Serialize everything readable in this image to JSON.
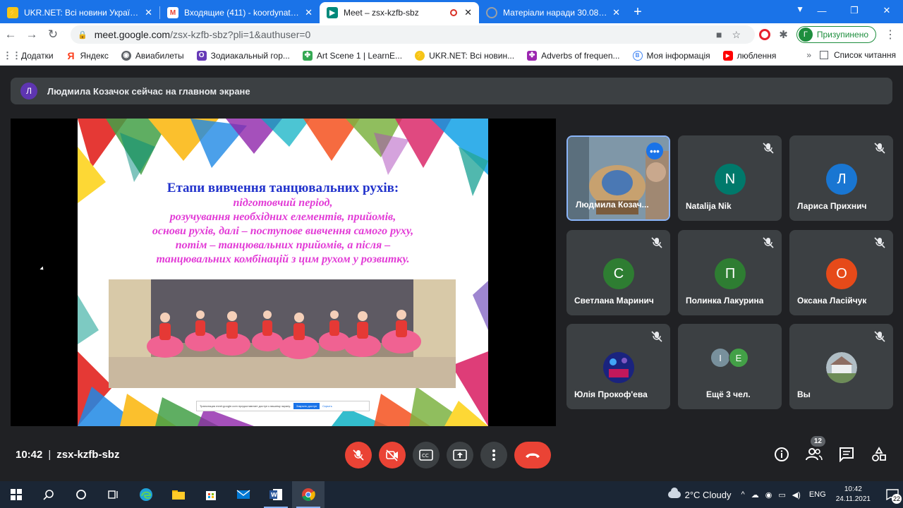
{
  "browser": {
    "tabs": [
      {
        "label": "UKR.NET: Всі новини України, ос",
        "favicon": "ukrnet-icon",
        "color": "#f5c518",
        "active": false
      },
      {
        "label": "Входящие (411) - koordynatzia@",
        "favicon": "gmail-icon",
        "color": "#ea4335",
        "active": false
      },
      {
        "label": "Meet – zsx-kzfb-sbz",
        "favicon": "meet-icon",
        "color": "#00897b",
        "active": true
      },
      {
        "label": "Матеріали наради 30.08 » КНЗ Н",
        "favicon": "site-icon",
        "color": "#9aa0a6",
        "active": false
      }
    ],
    "url_host": "meet.google.com",
    "url_path": "/zsx-kzfb-sbz?pli=1&authuser=0",
    "profile_initial": "Г",
    "profile_status": "Призупинено"
  },
  "bookmarks": {
    "items": [
      {
        "label": "Додатки",
        "icon": "apps-grid-icon",
        "color": "#5f6368"
      },
      {
        "label": "Яндекс",
        "icon": "yandex-icon",
        "color": "#fc3f1d"
      },
      {
        "label": "Авиабилеты",
        "icon": "globe-icon",
        "color": "#5f6368"
      },
      {
        "label": "Зодиакальный гор...",
        "icon": "zodiac-icon",
        "color": "#673ab7"
      },
      {
        "label": "Art Scene 1 | LearnE...",
        "icon": "learn-icon",
        "color": "#34a853"
      },
      {
        "label": "UKR.NET: Всі новин...",
        "icon": "ukrnet-icon",
        "color": "#f5c518"
      },
      {
        "label": "Adverbs of frequen...",
        "icon": "adverbs-icon",
        "color": "#9c27b0"
      },
      {
        "label": "Моя інформація",
        "icon": "info-icon",
        "color": "#4285f4"
      },
      {
        "label": "люблення",
        "icon": "youtube-icon",
        "color": "#ff0000"
      }
    ],
    "more": "»",
    "reading_list": "Список читання"
  },
  "meet": {
    "banner_initial": "Л",
    "banner_text": "Людмила Козачок сейчас на главном экране",
    "slide": {
      "title": "Етапи вивчення танцювальних рухів:",
      "lines": [
        "підготовчий період,",
        "розучування необхідних елементів, прийомів,",
        "основи рухів, далі – поступове вивчення самого руху,",
        "потім – танцювальних прийомів, а після –",
        "танцювальних комбінацій з цим рухом у розвитку."
      ],
      "share_notice": "Трансляция meet.google.com предоставляет доступ к вашему экрану.",
      "share_stop": "Закрыть доступ",
      "share_hide": "Скрыть"
    },
    "participants": [
      {
        "name": "Людмила Козач...",
        "initial": "",
        "color": "#3c4043",
        "video": true
      },
      {
        "name": "Natalija Nik",
        "initial": "N",
        "color": "#00796b"
      },
      {
        "name": "Лариса Прихнич",
        "initial": "Л",
        "color": "#1976d2"
      },
      {
        "name": "Светлана Маринич",
        "initial": "С",
        "color": "#2e7d32"
      },
      {
        "name": "Полинка Лакурина",
        "initial": "П",
        "color": "#2e7d32"
      },
      {
        "name": "Оксана Ласійчук",
        "initial": "О",
        "color": "#e64a19"
      },
      {
        "name": "Юлія Прокоф'ева",
        "initial": "",
        "color": "#1a237e"
      },
      {
        "name": "Ещё 3 чел.",
        "initial": "",
        "color": "#3c4043"
      },
      {
        "name": "Вы",
        "initial": "",
        "color": "#8d8d7a"
      }
    ],
    "others": [
      {
        "initial": "I",
        "color": "#78909c"
      },
      {
        "initial": "E",
        "color": "#43a047"
      }
    ],
    "time": "10:42",
    "meeting_code": "zsx-kzfb-sbz",
    "people_count": "12"
  },
  "taskbar": {
    "weather": "2°C  Cloudy",
    "language": "ENG",
    "time": "10:42",
    "date": "24.11.2021",
    "notifications": "22"
  }
}
